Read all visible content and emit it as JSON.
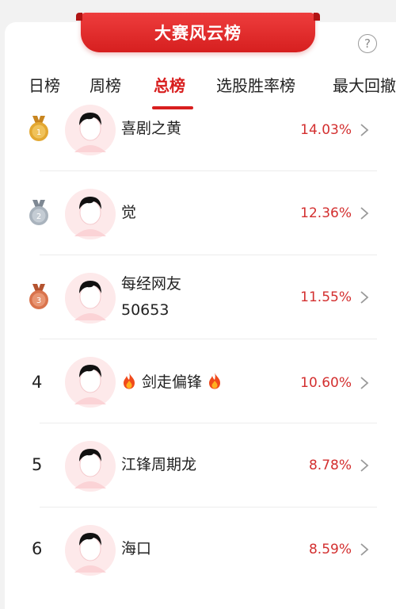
{
  "header": {
    "title": "大赛风云榜",
    "help_label": "?"
  },
  "tabs": [
    {
      "label": "日榜"
    },
    {
      "label": "周榜"
    },
    {
      "label": "总榜",
      "active": true
    },
    {
      "label": "选股胜率榜"
    },
    {
      "label": "最大回撤"
    }
  ],
  "ranking": [
    {
      "rank": "1",
      "name": "喜剧之黄",
      "value": "14.03%",
      "medal": "gold"
    },
    {
      "rank": "2",
      "name": "觉",
      "value": "12.36%",
      "medal": "silver"
    },
    {
      "rank": "3",
      "name_line1": "每经网友",
      "name_line2": "50653",
      "value": "11.55%",
      "medal": "bronze"
    },
    {
      "rank": "4",
      "name": "剑走偏锋",
      "value": "10.60%",
      "decor_icon": "fire-icon"
    },
    {
      "rank": "5",
      "name": "江锋周期龙",
      "value": "8.78%"
    },
    {
      "rank": "6",
      "name": "海口",
      "value": "8.59%"
    }
  ],
  "colors": {
    "accent": "#d81e1e",
    "value": "#d32f2f",
    "gold": "#e3a832",
    "silver": "#a9b3bd",
    "bronze": "#d9734c"
  }
}
